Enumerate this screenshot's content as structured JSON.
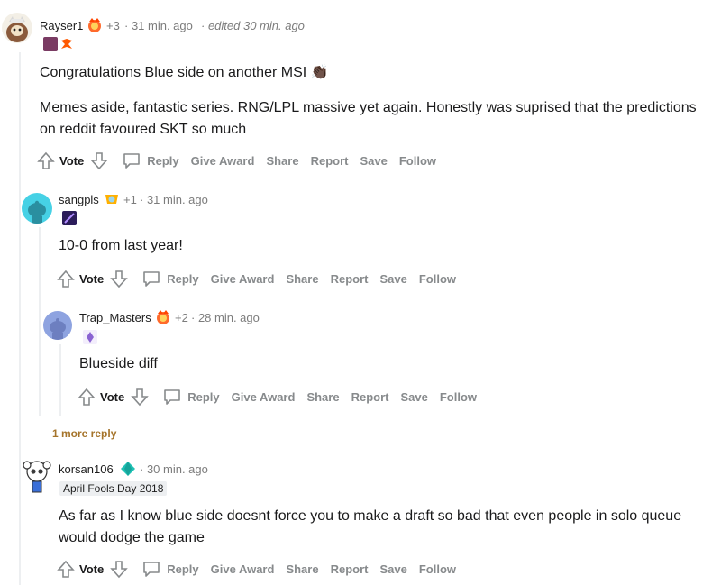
{
  "comments": [
    {
      "username": "Rayser1",
      "award_count": "+3",
      "time": "· 31 min. ago",
      "edited": "· edited 30 min. ago",
      "body_lines": [
        "Congratulations Blue side on another MSI 👏🏿"
      ],
      "body2": "Memes aside, fantastic series. RNG/LPL massive yet again. Honestly was suprised that the predictions on reddit favoured SKT so much"
    },
    {
      "username": "sangpls",
      "award_count": "+1",
      "time": "· 31 min. ago",
      "body": "10-0 from last year!"
    },
    {
      "username": "Trap_Masters",
      "award_count": "+2",
      "time": "· 28 min. ago",
      "body": "Blueside diff"
    },
    {
      "username": "korsan106",
      "time": "· 30 min. ago",
      "flair": "April Fools Day 2018",
      "body": "As far as I know blue side doesnt force you to make a draft so bad that even people in solo queue would dodge the game"
    }
  ],
  "actions": {
    "vote": "Vote",
    "reply": "Reply",
    "give_award": "Give Award",
    "share": "Share",
    "report": "Report",
    "save": "Save",
    "follow": "Follow"
  },
  "more_reply": "1 more reply",
  "colors": {
    "accent_more_reply": "#a5742b",
    "meta_gray": "#7c7c7c",
    "action_gray": "#878a8c",
    "thread_line": "#edeff1"
  },
  "icons": [
    "upvote-icon",
    "downvote-icon",
    "comment-bubble-icon",
    "award-icon",
    "diamond-icon",
    "snoo-avatar"
  ]
}
